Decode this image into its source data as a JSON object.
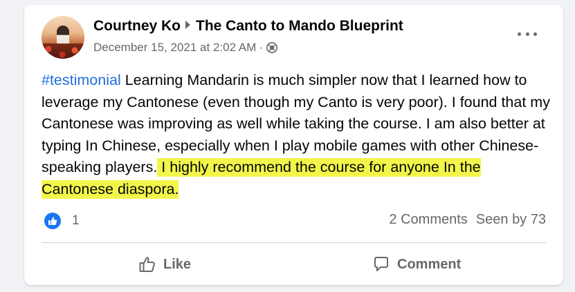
{
  "post": {
    "author": "Courtney Ko",
    "group": "The Canto to Mando Blueprint",
    "timestamp": "December 15, 2021 at 2:02 AM",
    "separator_dot": "·",
    "privacy_icon": "globe-icon",
    "more_icon": "more-options-icon",
    "hashtag": "#testimonial",
    "body_plain": " Learning Mandarin is much simpler now that I learned how to leverage my Cantonese (even though my Canto is very poor). I found that my Cantonese was improving as well while taking the course. I am also better at typing In Chinese, especially when I play mobile games with other Chinese-speaking players.",
    "body_highlighted": " I highly recommend the course for anyone In the Cantonese diaspora.",
    "highlight_color": "#f3f64a",
    "hashtag_color": "#216fdb"
  },
  "reactions": {
    "like_icon": "thumbs-up-icon",
    "like_count": "1",
    "comments_text": "2 Comments",
    "seen_text": "Seen by 73",
    "accent": "#1877f2"
  },
  "actions": {
    "like_label": "Like",
    "comment_label": "Comment"
  }
}
